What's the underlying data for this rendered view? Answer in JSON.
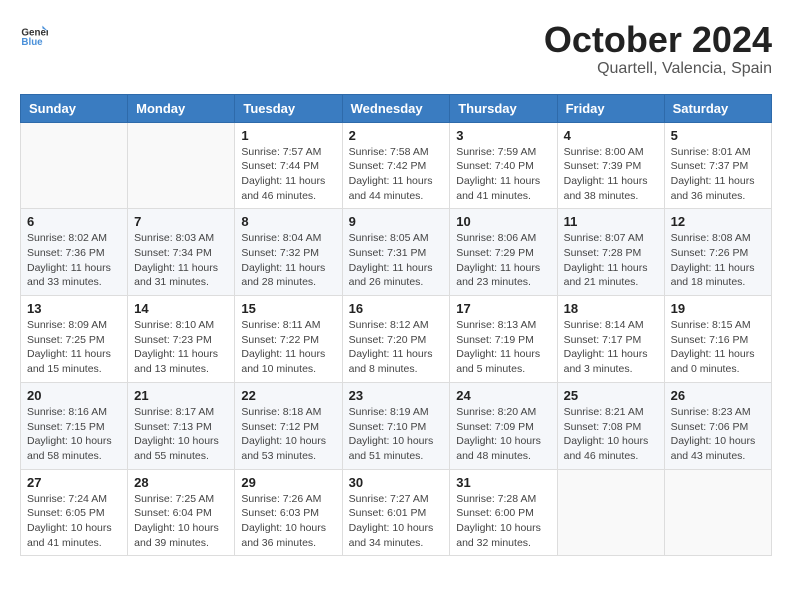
{
  "header": {
    "logo_general": "General",
    "logo_blue": "Blue",
    "month": "October 2024",
    "location": "Quartell, Valencia, Spain"
  },
  "weekdays": [
    "Sunday",
    "Monday",
    "Tuesday",
    "Wednesday",
    "Thursday",
    "Friday",
    "Saturday"
  ],
  "weeks": [
    [
      {
        "day": "",
        "sunrise": "",
        "sunset": "",
        "daylight": ""
      },
      {
        "day": "",
        "sunrise": "",
        "sunset": "",
        "daylight": ""
      },
      {
        "day": "1",
        "sunrise": "Sunrise: 7:57 AM",
        "sunset": "Sunset: 7:44 PM",
        "daylight": "Daylight: 11 hours and 46 minutes."
      },
      {
        "day": "2",
        "sunrise": "Sunrise: 7:58 AM",
        "sunset": "Sunset: 7:42 PM",
        "daylight": "Daylight: 11 hours and 44 minutes."
      },
      {
        "day": "3",
        "sunrise": "Sunrise: 7:59 AM",
        "sunset": "Sunset: 7:40 PM",
        "daylight": "Daylight: 11 hours and 41 minutes."
      },
      {
        "day": "4",
        "sunrise": "Sunrise: 8:00 AM",
        "sunset": "Sunset: 7:39 PM",
        "daylight": "Daylight: 11 hours and 38 minutes."
      },
      {
        "day": "5",
        "sunrise": "Sunrise: 8:01 AM",
        "sunset": "Sunset: 7:37 PM",
        "daylight": "Daylight: 11 hours and 36 minutes."
      }
    ],
    [
      {
        "day": "6",
        "sunrise": "Sunrise: 8:02 AM",
        "sunset": "Sunset: 7:36 PM",
        "daylight": "Daylight: 11 hours and 33 minutes."
      },
      {
        "day": "7",
        "sunrise": "Sunrise: 8:03 AM",
        "sunset": "Sunset: 7:34 PM",
        "daylight": "Daylight: 11 hours and 31 minutes."
      },
      {
        "day": "8",
        "sunrise": "Sunrise: 8:04 AM",
        "sunset": "Sunset: 7:32 PM",
        "daylight": "Daylight: 11 hours and 28 minutes."
      },
      {
        "day": "9",
        "sunrise": "Sunrise: 8:05 AM",
        "sunset": "Sunset: 7:31 PM",
        "daylight": "Daylight: 11 hours and 26 minutes."
      },
      {
        "day": "10",
        "sunrise": "Sunrise: 8:06 AM",
        "sunset": "Sunset: 7:29 PM",
        "daylight": "Daylight: 11 hours and 23 minutes."
      },
      {
        "day": "11",
        "sunrise": "Sunrise: 8:07 AM",
        "sunset": "Sunset: 7:28 PM",
        "daylight": "Daylight: 11 hours and 21 minutes."
      },
      {
        "day": "12",
        "sunrise": "Sunrise: 8:08 AM",
        "sunset": "Sunset: 7:26 PM",
        "daylight": "Daylight: 11 hours and 18 minutes."
      }
    ],
    [
      {
        "day": "13",
        "sunrise": "Sunrise: 8:09 AM",
        "sunset": "Sunset: 7:25 PM",
        "daylight": "Daylight: 11 hours and 15 minutes."
      },
      {
        "day": "14",
        "sunrise": "Sunrise: 8:10 AM",
        "sunset": "Sunset: 7:23 PM",
        "daylight": "Daylight: 11 hours and 13 minutes."
      },
      {
        "day": "15",
        "sunrise": "Sunrise: 8:11 AM",
        "sunset": "Sunset: 7:22 PM",
        "daylight": "Daylight: 11 hours and 10 minutes."
      },
      {
        "day": "16",
        "sunrise": "Sunrise: 8:12 AM",
        "sunset": "Sunset: 7:20 PM",
        "daylight": "Daylight: 11 hours and 8 minutes."
      },
      {
        "day": "17",
        "sunrise": "Sunrise: 8:13 AM",
        "sunset": "Sunset: 7:19 PM",
        "daylight": "Daylight: 11 hours and 5 minutes."
      },
      {
        "day": "18",
        "sunrise": "Sunrise: 8:14 AM",
        "sunset": "Sunset: 7:17 PM",
        "daylight": "Daylight: 11 hours and 3 minutes."
      },
      {
        "day": "19",
        "sunrise": "Sunrise: 8:15 AM",
        "sunset": "Sunset: 7:16 PM",
        "daylight": "Daylight: 11 hours and 0 minutes."
      }
    ],
    [
      {
        "day": "20",
        "sunrise": "Sunrise: 8:16 AM",
        "sunset": "Sunset: 7:15 PM",
        "daylight": "Daylight: 10 hours and 58 minutes."
      },
      {
        "day": "21",
        "sunrise": "Sunrise: 8:17 AM",
        "sunset": "Sunset: 7:13 PM",
        "daylight": "Daylight: 10 hours and 55 minutes."
      },
      {
        "day": "22",
        "sunrise": "Sunrise: 8:18 AM",
        "sunset": "Sunset: 7:12 PM",
        "daylight": "Daylight: 10 hours and 53 minutes."
      },
      {
        "day": "23",
        "sunrise": "Sunrise: 8:19 AM",
        "sunset": "Sunset: 7:10 PM",
        "daylight": "Daylight: 10 hours and 51 minutes."
      },
      {
        "day": "24",
        "sunrise": "Sunrise: 8:20 AM",
        "sunset": "Sunset: 7:09 PM",
        "daylight": "Daylight: 10 hours and 48 minutes."
      },
      {
        "day": "25",
        "sunrise": "Sunrise: 8:21 AM",
        "sunset": "Sunset: 7:08 PM",
        "daylight": "Daylight: 10 hours and 46 minutes."
      },
      {
        "day": "26",
        "sunrise": "Sunrise: 8:23 AM",
        "sunset": "Sunset: 7:06 PM",
        "daylight": "Daylight: 10 hours and 43 minutes."
      }
    ],
    [
      {
        "day": "27",
        "sunrise": "Sunrise: 7:24 AM",
        "sunset": "Sunset: 6:05 PM",
        "daylight": "Daylight: 10 hours and 41 minutes."
      },
      {
        "day": "28",
        "sunrise": "Sunrise: 7:25 AM",
        "sunset": "Sunset: 6:04 PM",
        "daylight": "Daylight: 10 hours and 39 minutes."
      },
      {
        "day": "29",
        "sunrise": "Sunrise: 7:26 AM",
        "sunset": "Sunset: 6:03 PM",
        "daylight": "Daylight: 10 hours and 36 minutes."
      },
      {
        "day": "30",
        "sunrise": "Sunrise: 7:27 AM",
        "sunset": "Sunset: 6:01 PM",
        "daylight": "Daylight: 10 hours and 34 minutes."
      },
      {
        "day": "31",
        "sunrise": "Sunrise: 7:28 AM",
        "sunset": "Sunset: 6:00 PM",
        "daylight": "Daylight: 10 hours and 32 minutes."
      },
      {
        "day": "",
        "sunrise": "",
        "sunset": "",
        "daylight": ""
      },
      {
        "day": "",
        "sunrise": "",
        "sunset": "",
        "daylight": ""
      }
    ]
  ]
}
